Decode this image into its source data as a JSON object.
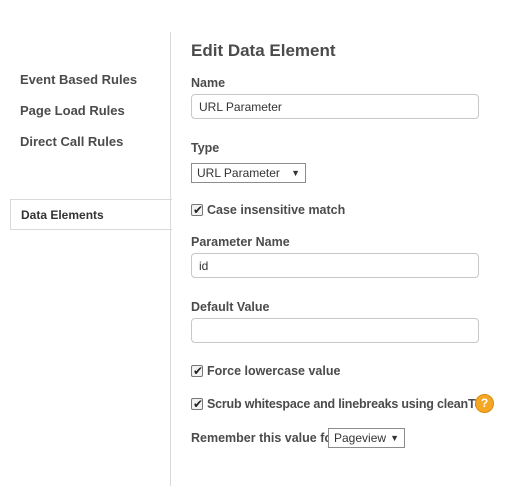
{
  "sidebar": {
    "items": [
      {
        "label": "Event Based Rules"
      },
      {
        "label": "Page Load Rules"
      },
      {
        "label": "Direct Call Rules"
      },
      {
        "label": "Data Elements"
      }
    ]
  },
  "form": {
    "title": "Edit Data Element",
    "name_label": "Name",
    "name_value": "URL Parameter",
    "type_label": "Type",
    "type_selected": "URL Parameter",
    "case_insensitive_label": "Case insensitive match",
    "case_insensitive_checked": true,
    "parameter_name_label": "Parameter Name",
    "parameter_name_value": "id",
    "default_value_label": "Default Value",
    "default_value_value": "",
    "force_lowercase_label": "Force lowercase value",
    "force_lowercase_checked": true,
    "scrub_whitespace_label": "Scrub whitespace and linebreaks using cleanText",
    "scrub_whitespace_checked": true,
    "help_icon_glyph": "?",
    "remember_label": "Remember this value for",
    "remember_selected": "Pageview"
  },
  "icons": {
    "help": "question-mark-icon",
    "dropdown": "triangle-down-icon",
    "check": "checkmark-icon"
  },
  "colors": {
    "help_icon": "#f5a623",
    "divider": "#d9d9d9",
    "text": "#4b4b4b"
  }
}
